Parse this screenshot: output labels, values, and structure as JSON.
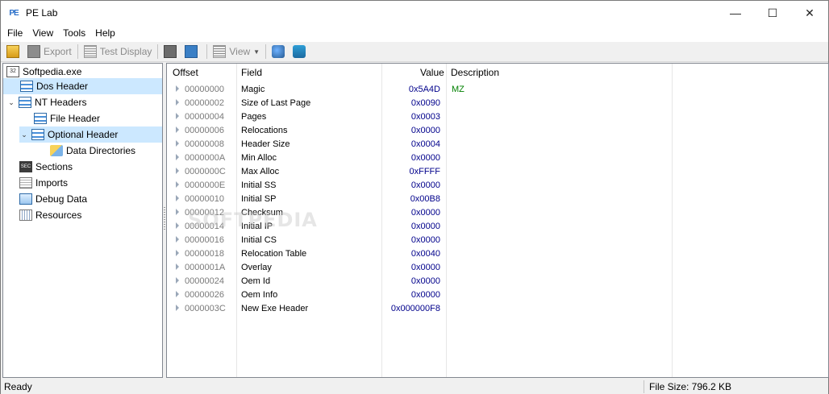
{
  "window": {
    "title": "PE Lab",
    "app_icon": "PE",
    "minimize": "—",
    "maximize": "☐",
    "close": "✕"
  },
  "menu": [
    "File",
    "View",
    "Tools",
    "Help"
  ],
  "toolbar": {
    "export_label": "Export",
    "test_display_label": "Test Display",
    "view_label": "View"
  },
  "tree": {
    "root": "Softpedia.exe",
    "dos_header": "Dos Header",
    "nt_headers": "NT Headers",
    "file_header": "File Header",
    "optional_header": "Optional Header",
    "data_directories": "Data Directories",
    "sections": "Sections",
    "imports": "Imports",
    "debug_data": "Debug Data",
    "resources": "Resources",
    "root_icon": "32"
  },
  "grid": {
    "headers": {
      "offset": "Offset",
      "field": "Field",
      "value": "Value",
      "description": "Description"
    },
    "rows": [
      {
        "offset": "00000000",
        "field": "Magic",
        "value": "0x5A4D",
        "description": "MZ"
      },
      {
        "offset": "00000002",
        "field": "Size of Last Page",
        "value": "0x0090",
        "description": ""
      },
      {
        "offset": "00000004",
        "field": "Pages",
        "value": "0x0003",
        "description": ""
      },
      {
        "offset": "00000006",
        "field": "Relocations",
        "value": "0x0000",
        "description": ""
      },
      {
        "offset": "00000008",
        "field": "Header Size",
        "value": "0x0004",
        "description": ""
      },
      {
        "offset": "0000000A",
        "field": "Min Alloc",
        "value": "0x0000",
        "description": ""
      },
      {
        "offset": "0000000C",
        "field": "Max Alloc",
        "value": "0xFFFF",
        "description": ""
      },
      {
        "offset": "0000000E",
        "field": "Initial SS",
        "value": "0x0000",
        "description": ""
      },
      {
        "offset": "00000010",
        "field": "Initial SP",
        "value": "0x00B8",
        "description": ""
      },
      {
        "offset": "00000012",
        "field": "Checksum",
        "value": "0x0000",
        "description": ""
      },
      {
        "offset": "00000014",
        "field": "Initial IP",
        "value": "0x0000",
        "description": ""
      },
      {
        "offset": "00000016",
        "field": "Initial CS",
        "value": "0x0000",
        "description": ""
      },
      {
        "offset": "00000018",
        "field": "Relocation Table",
        "value": "0x0040",
        "description": ""
      },
      {
        "offset": "0000001A",
        "field": "Overlay",
        "value": "0x0000",
        "description": ""
      },
      {
        "offset": "00000024",
        "field": "Oem Id",
        "value": "0x0000",
        "description": ""
      },
      {
        "offset": "00000026",
        "field": "Oem Info",
        "value": "0x0000",
        "description": ""
      },
      {
        "offset": "0000003C",
        "field": "New Exe Header",
        "value": "0x000000F8",
        "description": ""
      }
    ]
  },
  "status": {
    "left": "Ready",
    "right": "File Size: 796.2 KB"
  },
  "watermark": "SOFTPEDIA",
  "colors": {
    "value_text": "#00008b",
    "description_text": "#008000",
    "selection": "#cce8ff"
  }
}
